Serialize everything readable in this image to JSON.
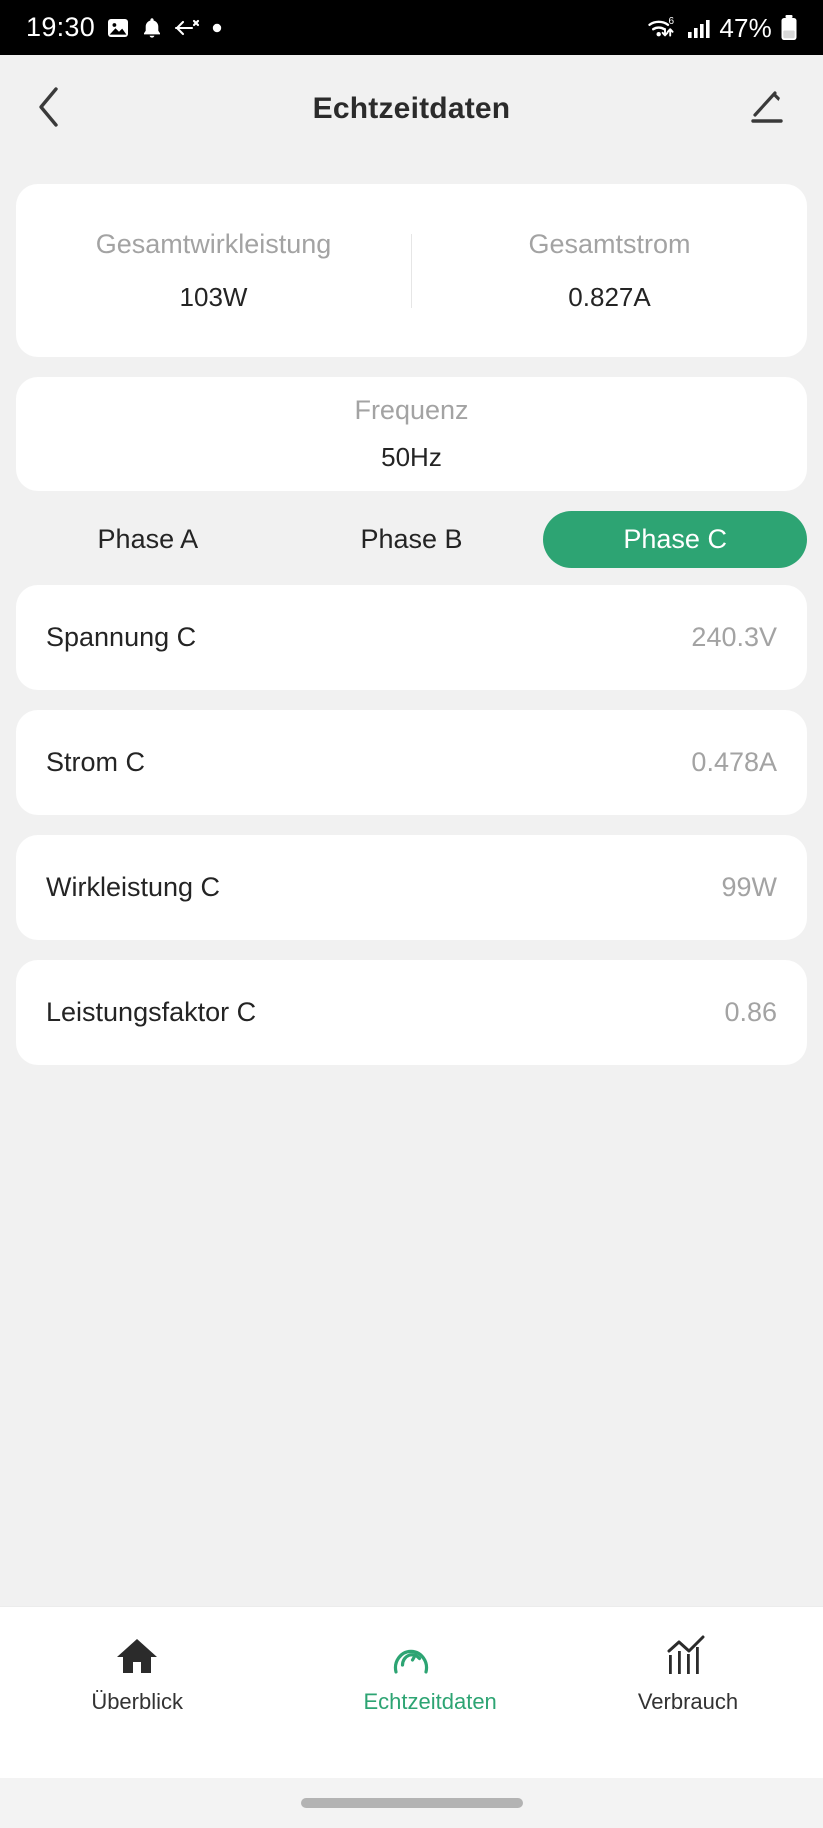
{
  "status_bar": {
    "time": "19:30",
    "battery_percent": "47%",
    "left_icons": [
      "image-icon",
      "notification-bell-icon",
      "airplane-arrow-icon",
      "dot-icon"
    ],
    "right_icons": [
      "wifi-6-icon",
      "cellular-signal-icon",
      "battery-icon"
    ]
  },
  "app_bar": {
    "title": "Echtzeitdaten",
    "back_icon": "chevron-left-icon",
    "edit_icon": "pencil-edit-icon"
  },
  "summary": {
    "total_power": {
      "label": "Gesamtwirkleistung",
      "value": "103W"
    },
    "total_current": {
      "label": "Gesamtstrom",
      "value": "0.827A"
    }
  },
  "frequency": {
    "label": "Frequenz",
    "value": "50Hz"
  },
  "phase_tabs": {
    "items": [
      {
        "label": "Phase A",
        "active": false
      },
      {
        "label": "Phase B",
        "active": false
      },
      {
        "label": "Phase C",
        "active": true
      }
    ]
  },
  "metrics": [
    {
      "label": "Spannung C",
      "value": "240.3V"
    },
    {
      "label": "Strom C",
      "value": "0.478A"
    },
    {
      "label": "Wirkleistung C",
      "value": "99W"
    },
    {
      "label": "Leistungsfaktor C",
      "value": "0.86"
    }
  ],
  "bottom_nav": {
    "items": [
      {
        "label": "Überblick",
        "icon": "home-icon",
        "active": false
      },
      {
        "label": "Echtzeitdaten",
        "icon": "gauge-icon",
        "active": true
      },
      {
        "label": "Verbrauch",
        "icon": "bar-chart-icon",
        "active": false
      }
    ]
  },
  "colors": {
    "accent_green": "#2da473",
    "page_background": "#f1f1f1",
    "card_background": "#ffffff",
    "muted_text": "#a3a3a3",
    "primary_text": "#242424"
  }
}
